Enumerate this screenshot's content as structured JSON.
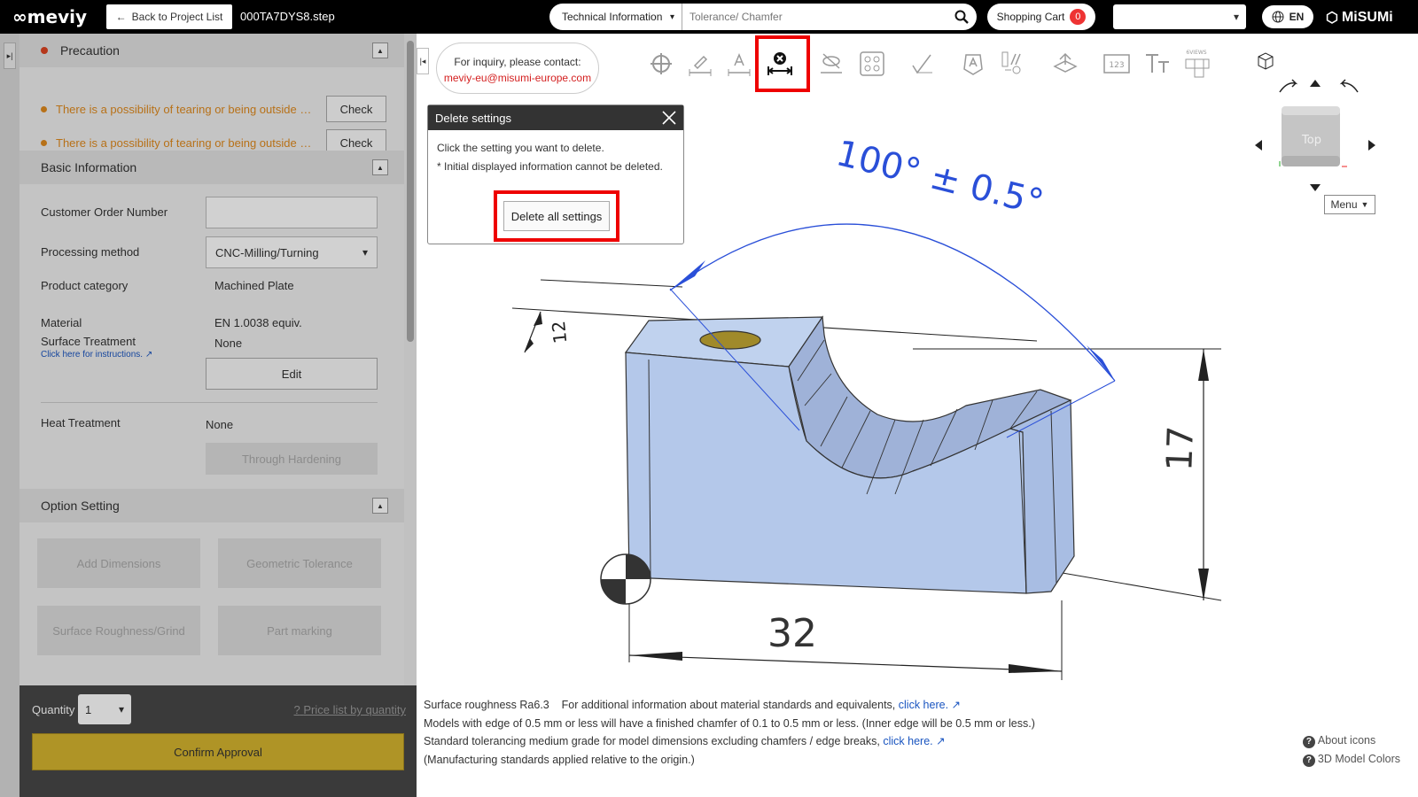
{
  "topbar": {
    "logo": "meviy",
    "back_label": "Back to Project List",
    "filename": "000TA7DYS8.step",
    "search_category": "Technical Information",
    "search_placeholder": "Tolerance/ Chamfer",
    "cart_label": "Shopping Cart",
    "cart_count": "0",
    "lang": "EN",
    "brand": "MiSUMi"
  },
  "precaution": {
    "title": "Precaution",
    "items": [
      {
        "text": "There is a possibility of tearing or being outside the machinable range",
        "button": "Check"
      },
      {
        "text": "There is a possibility of tearing or being outside the machinable range",
        "button": "Check"
      }
    ]
  },
  "basic_info": {
    "title": "Basic Information",
    "customer_order_label": "Customer Order Number",
    "customer_order_value": "",
    "processing_label": "Processing method",
    "processing_value": "CNC-Milling/Turning",
    "category_label": "Product category",
    "category_value": "Machined Plate",
    "material_label": "Material",
    "material_value": "EN 1.0038 equiv.",
    "surface_label": "Surface Treatment",
    "surface_value": "None",
    "instructions_link": "Click here for instructions.",
    "edit_label": "Edit",
    "heat_label": "Heat Treatment",
    "heat_value": "None",
    "through_hardening": "Through Hardening"
  },
  "options": {
    "title": "Option Setting",
    "buttons": [
      "Add Dimensions",
      "Geometric Tolerance",
      "Surface Roughness/Grind",
      "Part marking"
    ]
  },
  "order": {
    "quantity_label": "Quantity",
    "quantity_value": "1",
    "price_link": "Price list by quantity",
    "confirm_label": "Confirm Approval"
  },
  "viewer": {
    "inquiry_line1": "For inquiry, please contact:",
    "inquiry_email": "meviy-eu@misumi-europe.com",
    "popup_title": "Delete settings",
    "popup_line1": "Click the setting you want to delete.",
    "popup_line2": "* Initial displayed information cannot be deleted.",
    "delete_all_label": "Delete all settings",
    "menu_label": "Menu",
    "cube_label": "Top",
    "dim_angle": "100° ± 0.5°",
    "dim_width": "32",
    "dim_height": "17",
    "dim_small": "12",
    "note_roughness": "Surface roughness Ra6.3",
    "note_material_info": "For additional information about material standards and equivalents,",
    "note_click_here": "click here.",
    "note_chamfer": "Models with edge of 0.5 mm or less will have a finished chamfer of 0.1 to 0.5 mm or less. (Inner edge will be 0.5 mm or less.)",
    "note_tolerance": "Standard tolerancing medium grade for model dimensions excluding chamfers / edge breaks,",
    "note_origin": "(Manufacturing standards applied relative to the origin.)",
    "about_icons": "About icons",
    "model_colors": "3D Model Colors",
    "toolbar_views_tag": "6VIEWS"
  },
  "colors": {
    "accent_red": "#e00000",
    "confirm_yellow": "#d6b52f",
    "model_fill": "#b4c8ea",
    "dimension_blue": "#2a4fd8"
  }
}
